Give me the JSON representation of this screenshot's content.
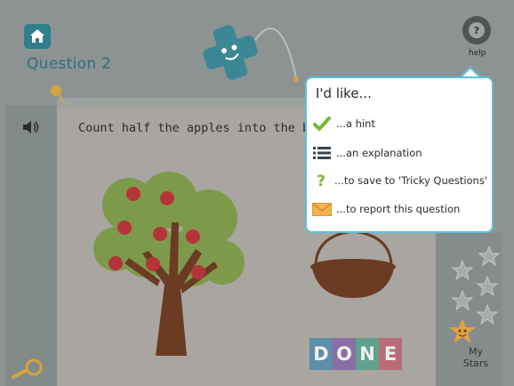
{
  "header": {
    "question_label": "Question 2",
    "help_label": "help"
  },
  "question": {
    "text": "Count half the apples into the basket."
  },
  "popup": {
    "title": "I'd like...",
    "items": [
      {
        "icon": "check-icon",
        "label": "...a hint"
      },
      {
        "icon": "list-icon",
        "label": "...an explanation"
      },
      {
        "icon": "question-mark-icon",
        "label": "...to save to 'Tricky Questions'"
      },
      {
        "icon": "envelope-icon",
        "label": "...to report this question"
      }
    ]
  },
  "done_button": {
    "letters": [
      "D",
      "O",
      "N",
      "E"
    ],
    "colors": [
      "#5f8ea8",
      "#8a6ea6",
      "#5fa18a",
      "#b86c77"
    ]
  },
  "my_stars": {
    "label_line1": "My",
    "label_line2": "Stars"
  },
  "colors": {
    "accent": "#5ec0d6",
    "teal": "#2e7e8d",
    "star_orange": "#e1a33b",
    "apple_red": "#c0333a"
  }
}
